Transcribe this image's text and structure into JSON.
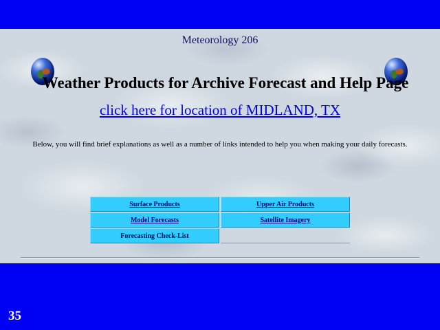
{
  "header": {
    "course": "Meteorology 206",
    "title": "Weather Products for Archive Forecast and Help Page"
  },
  "location_link": "click here for location of  MIDLAND, TX",
  "intro_text": "Below, you will find brief explanations as well as a number of links intended to help you when making your daily forecasts.",
  "links_table": {
    "surface_products": "Surface Products",
    "upper_air_products": "Upper Air Products",
    "model_forecasts": "Model Forecasts",
    "satellite_imagery": "Satellite Imagery",
    "forecasting_checklist": "Forecasting Check-List"
  },
  "slide_number": "35",
  "icons": {
    "left": "globe-icon",
    "right": "globe-icon"
  },
  "colors": {
    "slide_background": "#0000f5",
    "cell_background": "#33ccff",
    "link": "#0000e0"
  }
}
